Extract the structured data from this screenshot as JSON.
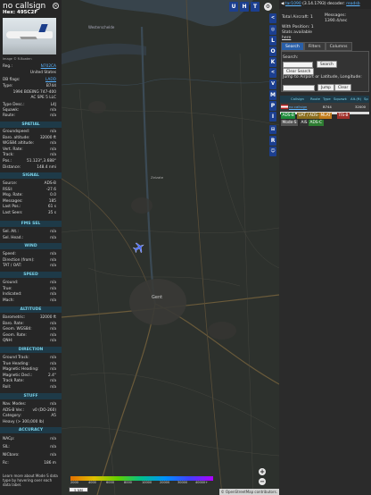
{
  "aircraft": {
    "callsign": "no callsign",
    "hex": "Hex: 495C2F",
    "image_credit": "Image © R.Boaten",
    "reg_label": "Reg.:",
    "reg": "N702CA",
    "country": "United States",
    "dbflags_label": "DB flags:",
    "dbflags": "LADD",
    "type_label": "Type:",
    "type": "B744",
    "desc": "1994 BOEING 747-400",
    "operator": "AC SPE 5 LLC",
    "typedesc_label": "Type Desc.:",
    "typedesc": "L4J",
    "squawk_label": "Squawk:",
    "squawk": "n/a",
    "route_label": "Route:",
    "route": "n/a"
  },
  "sections": {
    "spatial": "SPATIAL",
    "signal": "SIGNAL",
    "fmssel": "FMS SEL",
    "wind": "WIND",
    "speed": "SPEED",
    "altitude": "ALTITUDE",
    "direction": "DIRECTION",
    "stuff": "STUFF",
    "accuracy": "ACCURACY"
  },
  "spatial": [
    {
      "label": "Groundspeed:",
      "value": "n/a"
    },
    {
      "label": "Baro. altitude:",
      "value": "32000 ft"
    },
    {
      "label": "WGS84 altitude:",
      "value": "n/a"
    },
    {
      "label": "Vert. Rate:",
      "value": "n/a"
    },
    {
      "label": "Track:",
      "value": "n/a"
    },
    {
      "label": "Pos.:",
      "value": "51.123°,3.688°"
    },
    {
      "label": "Distance:",
      "value": "148.4 nmi"
    }
  ],
  "signal": [
    {
      "label": "Source:",
      "value": "ADS-B"
    },
    {
      "label": "RSSI:",
      "value": "-27.6"
    },
    {
      "label": "Msg. Rate:",
      "value": "0.0"
    },
    {
      "label": "Messages:",
      "value": "185"
    },
    {
      "label": "Last Pos.:",
      "value": "61 s"
    },
    {
      "label": "Last Seen:",
      "value": "35 s"
    }
  ],
  "fmssel": [
    {
      "label": "Sel. Alt.:",
      "value": "n/a"
    },
    {
      "label": "Sel. Head.:",
      "value": "n/a"
    }
  ],
  "wind": [
    {
      "label": "Speed:",
      "value": "n/a"
    },
    {
      "label": "Direction (from):",
      "value": "n/a"
    },
    {
      "label": "TAT / OAT:",
      "value": "n/a"
    }
  ],
  "speed": [
    {
      "label": "Ground:",
      "value": "n/a"
    },
    {
      "label": "True:",
      "value": "n/a"
    },
    {
      "label": "Indicated:",
      "value": "n/a"
    },
    {
      "label": "Mach:",
      "value": "n/a"
    }
  ],
  "altitude": [
    {
      "label": "Barometric:",
      "value": "32000 ft"
    },
    {
      "label": "Baro. Rate:",
      "value": "n/a"
    },
    {
      "label": "Geom. WGS84:",
      "value": "n/a"
    },
    {
      "label": "Geom. Rate:",
      "value": "n/a"
    },
    {
      "label": "QNH:",
      "value": "n/a"
    }
  ],
  "direction": [
    {
      "label": "Ground Track:",
      "value": "n/a"
    },
    {
      "label": "True Heading:",
      "value": "n/a"
    },
    {
      "label": "Magnetic Heading:",
      "value": "n/a"
    },
    {
      "label": "Magnetic Decl.:",
      "value": "2.4°"
    },
    {
      "label": "Track Rate:",
      "value": "n/a"
    },
    {
      "label": "Roll:",
      "value": "n/a"
    }
  ],
  "stuff": [
    {
      "label": "Nav. Modes:",
      "value": "n/a"
    },
    {
      "label": "ADS-B Ver.:",
      "value": "v0 (DO-260)"
    },
    {
      "label": "Category:",
      "value": "A5"
    },
    {
      "label": "Heavy (> 300,000 lb)",
      "value": ""
    }
  ],
  "accuracy": [
    {
      "label": "NACp:",
      "value": "n/a"
    },
    {
      "label": "SIL:",
      "value": "n/a"
    },
    {
      "label": "NICbaro:",
      "value": "n/a"
    },
    {
      "label": "Rc:",
      "value": "186 m"
    }
  ],
  "info_footer": "Learn more about Mode S data type by hovering over each data label.",
  "map": {
    "top_buttons": [
      "U",
      "H",
      "T"
    ],
    "side_buttons": [
      "L",
      "O",
      "K",
      "M",
      "P",
      "I",
      "R"
    ],
    "place_labels": [
      "Gent",
      "Westerschelde",
      "Zelzate"
    ],
    "attribution": "© OpenStreetMap contributors.",
    "scale": "5 NM",
    "alt_ticks": [
      "2000",
      "4000",
      "6000",
      "8000",
      "10000",
      "20000",
      "30000",
      "40000+"
    ],
    "zoom_in": "+",
    "zoom_out": "−"
  },
  "panel": {
    "version_link": "tar1090",
    "version": "(3.14.1793)",
    "decoder_label": "decoder:",
    "decoder": "readsb",
    "total_label": "Total Aircraft:",
    "total": "1",
    "messages_label": "Messages:",
    "messages": "1390.4/sec",
    "withpos_label": "With Position:",
    "withpos": "1",
    "stats_label": "Stats available",
    "stats_link": "here",
    "tabs": [
      "Search",
      "Filters",
      "Columns"
    ],
    "search_label": "Search:",
    "search_button": "Search",
    "clear_search": "Clear Search",
    "jump_label": "Jump to Airport or Latitude, Longitude:",
    "jump_button": "Jump",
    "clear_button": "Clear",
    "columns": [
      "Callsign",
      "Route",
      "Type",
      "Squawk",
      "Alt.(ft)",
      "Sp"
    ],
    "row": {
      "callsign": "no callsign",
      "type": "B744",
      "alt": "32000"
    },
    "legend": [
      {
        "label": "ADS-B",
        "color": "#1e8a3a"
      },
      {
        "label": "UAT / ADS-R",
        "color": "#8a6d1e"
      },
      {
        "label": "MLAT",
        "color": "#c07a1a"
      },
      {
        "label": "TIS-B",
        "color": "#a0302a"
      },
      {
        "label": "Mode-S",
        "color": "#555555"
      },
      {
        "label": "AIS",
        "color": "#333333"
      },
      {
        "label": "ADS-C",
        "color": "#2e7d32"
      }
    ]
  }
}
